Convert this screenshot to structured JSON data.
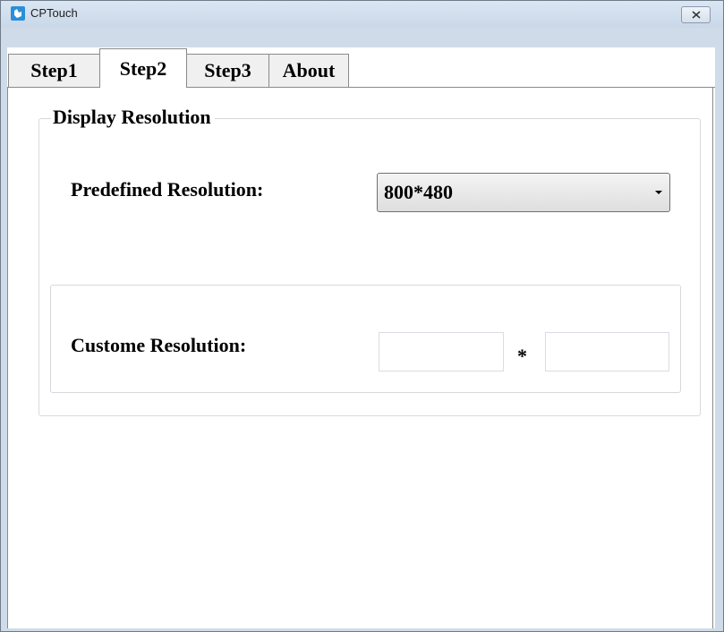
{
  "window": {
    "title": "CPTouch"
  },
  "tabs": [
    {
      "label": "Step1",
      "active": false
    },
    {
      "label": "Step2",
      "active": true
    },
    {
      "label": "Step3",
      "active": false
    },
    {
      "label": "About",
      "active": false
    }
  ],
  "display_resolution": {
    "group_title": "Display Resolution",
    "predefined_label": "Predefined Resolution:",
    "predefined_value": "800*480",
    "custom_label": "Custome Resolution:",
    "custom_width": "",
    "custom_height": "",
    "separator": "*"
  },
  "icons": {
    "app": "cptouch-app-icon",
    "close": "close-icon",
    "dropdown": "chevron-down-icon"
  },
  "colors": {
    "titlebar": "#cfdbe9",
    "app_icon": "#2a8fd8"
  }
}
